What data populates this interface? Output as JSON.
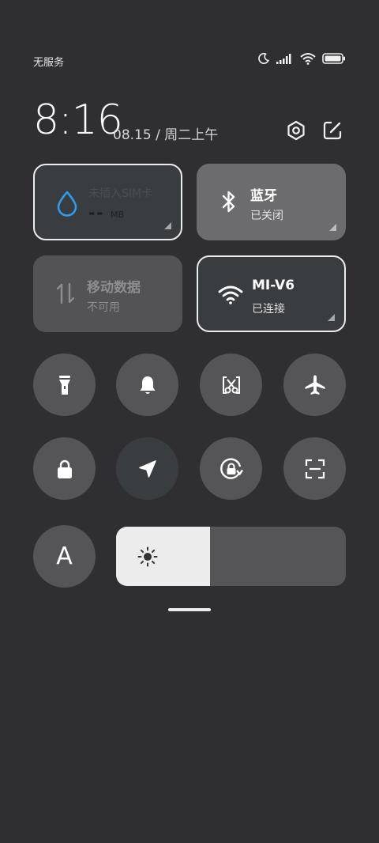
{
  "status_bar": {
    "carrier": "无服务",
    "icons": [
      "moon-icon",
      "signal-icon",
      "wifi-icon",
      "battery-icon"
    ]
  },
  "header": {
    "time": "8:16",
    "date": "08.15 / 周二上午",
    "icons": [
      "settings-icon",
      "edit-icon"
    ]
  },
  "tiles": {
    "data_usage": {
      "title": "未插入SIM卡",
      "value": "--",
      "unit": "MB",
      "icon": "water-drop-icon",
      "accent": "#2d9bf0"
    },
    "bluetooth": {
      "title": "蓝牙",
      "subtitle": "已关闭",
      "icon": "bluetooth-icon"
    },
    "mobile_data": {
      "title": "移动数据",
      "subtitle": "不可用",
      "icon": "data-arrows-icon"
    },
    "wifi": {
      "title": "MI-V6",
      "subtitle": "已连接",
      "icon": "wifi-icon"
    }
  },
  "toggles": [
    {
      "name": "flashlight",
      "icon": "flashlight-icon"
    },
    {
      "name": "sound",
      "icon": "bell-icon"
    },
    {
      "name": "screenshot",
      "icon": "scissors-icon"
    },
    {
      "name": "airplane-mode",
      "icon": "airplane-icon"
    },
    {
      "name": "lock-screen",
      "icon": "lock-icon"
    },
    {
      "name": "location",
      "icon": "location-arrow-icon"
    },
    {
      "name": "rotation-lock",
      "icon": "rotation-lock-icon"
    },
    {
      "name": "scanner",
      "icon": "scan-icon"
    },
    {
      "name": "auto-brightness",
      "icon": "auto-brightness-icon",
      "label": "A"
    }
  ],
  "brightness": {
    "level": 0.41,
    "icon": "sun-icon"
  },
  "colors": {
    "background": "#2f2f31",
    "tile_gray": "#555557",
    "tile_dark": "#3a3d40",
    "highlight": "#ececec",
    "accent": "#2d9bf0"
  }
}
